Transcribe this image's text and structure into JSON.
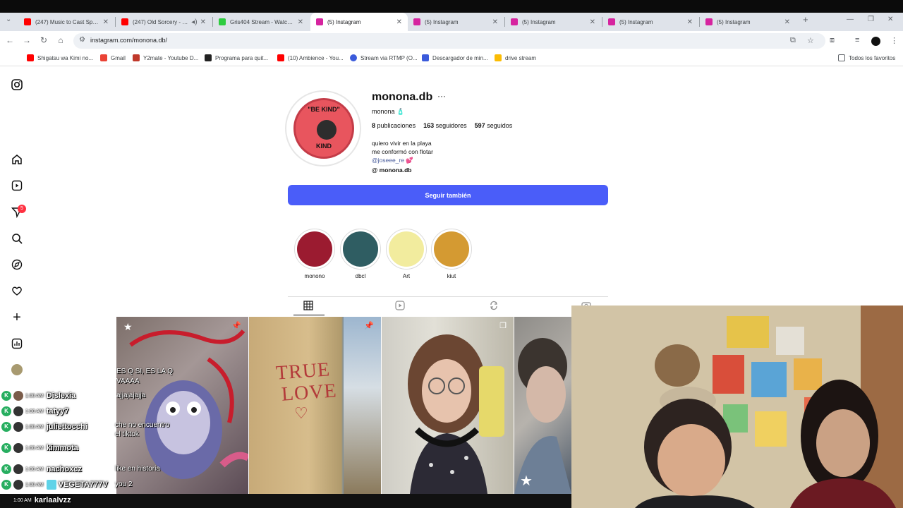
{
  "browser": {
    "tabs": [
      {
        "title": "(247) Music to Cast Spells",
        "color": "#ff0000"
      },
      {
        "title": "(247) Old Sorcery - Re",
        "color": "#ff0000"
      },
      {
        "title": "Gris404 Stream - Watch L",
        "color": "#2ecc40"
      },
      {
        "title": "(5) Instagram",
        "color": "#d6249f"
      },
      {
        "title": "(5) Instagram",
        "color": "#d6249f"
      },
      {
        "title": "(5) Instagram",
        "color": "#d6249f"
      },
      {
        "title": "(5) Instagram",
        "color": "#d6249f"
      },
      {
        "title": "(5) Instagram",
        "color": "#d6249f"
      }
    ],
    "url": "instagram.com/monona.db/",
    "bookmarks": [
      {
        "label": "Shigatsu wa Kimi no...",
        "color": "#ff0000"
      },
      {
        "label": "Gmail",
        "color": "#ea4335"
      },
      {
        "label": "Y2mate - Youtube D...",
        "color": "#c0392b"
      },
      {
        "label": "Programa para quit...",
        "color": "#222222"
      },
      {
        "label": "(10) Ambience - You...",
        "color": "#ff0000"
      },
      {
        "label": "Stream via RTMP (O...",
        "color": "#3b5bdb"
      },
      {
        "label": "Descargador de min...",
        "color": "#3b5bdb"
      },
      {
        "label": "drive stream",
        "color": "#fbbc04"
      }
    ],
    "bookmarks_folder": "Todos los favoritos"
  },
  "sidebar": {
    "notifications_count": "5"
  },
  "profile": {
    "username": "monona.db",
    "name": "monona",
    "name_emoji": "🧴",
    "posts_count": "8",
    "posts_label": "publicaciones",
    "followers_count": "163",
    "followers_label": "seguidores",
    "following_count": "597",
    "following_label": "seguidos",
    "bio_line1": "quiero vivir en la playa",
    "bio_line2": "me conformó con flotar",
    "bio_mention": "@joseee_re 💕",
    "threads_handle": "monona.db",
    "avatar_text_top": "\"BE KIND\"",
    "avatar_text_bottom": "KIND",
    "follow_button": "Seguir también"
  },
  "highlights": [
    {
      "label": "monono",
      "color": "#9b1b30"
    },
    {
      "label": "dbcl",
      "color": "#2f5d62"
    },
    {
      "label": "Art",
      "color": "#f2ec9e"
    },
    {
      "label": "kiut",
      "color": "#d49a32"
    }
  ],
  "posts": [
    {
      "overlay_lines": [
        "ES Q SI, ES LA Q",
        "VAAAA",
        "ajjajajajja"
      ]
    },
    {
      "overlay_lines": [
        "TRUE",
        "LOVE"
      ]
    },
    {
      "overlay_lines": []
    },
    {
      "overlay_lines": []
    }
  ],
  "chat": {
    "messages": [
      {
        "time": "1:00 AM",
        "user": "Dislexia"
      },
      {
        "time": "1:00 AM",
        "user": "tatyy7"
      },
      {
        "time": "1:00 AM",
        "user": "juliettocchi"
      },
      {
        "time": "1:00 AM",
        "user": "kimmota"
      },
      {
        "time": "1:00 AM",
        "user": "nachoxcz"
      },
      {
        "time": "1:00 AM",
        "user": "VEGETA777V"
      },
      {
        "time": "1:00 AM",
        "user": "karlaalvzz"
      }
    ],
    "overlay_texts": [
      "che no encuentro",
      "el tiktok",
      "like en historia",
      "you 2"
    ]
  }
}
